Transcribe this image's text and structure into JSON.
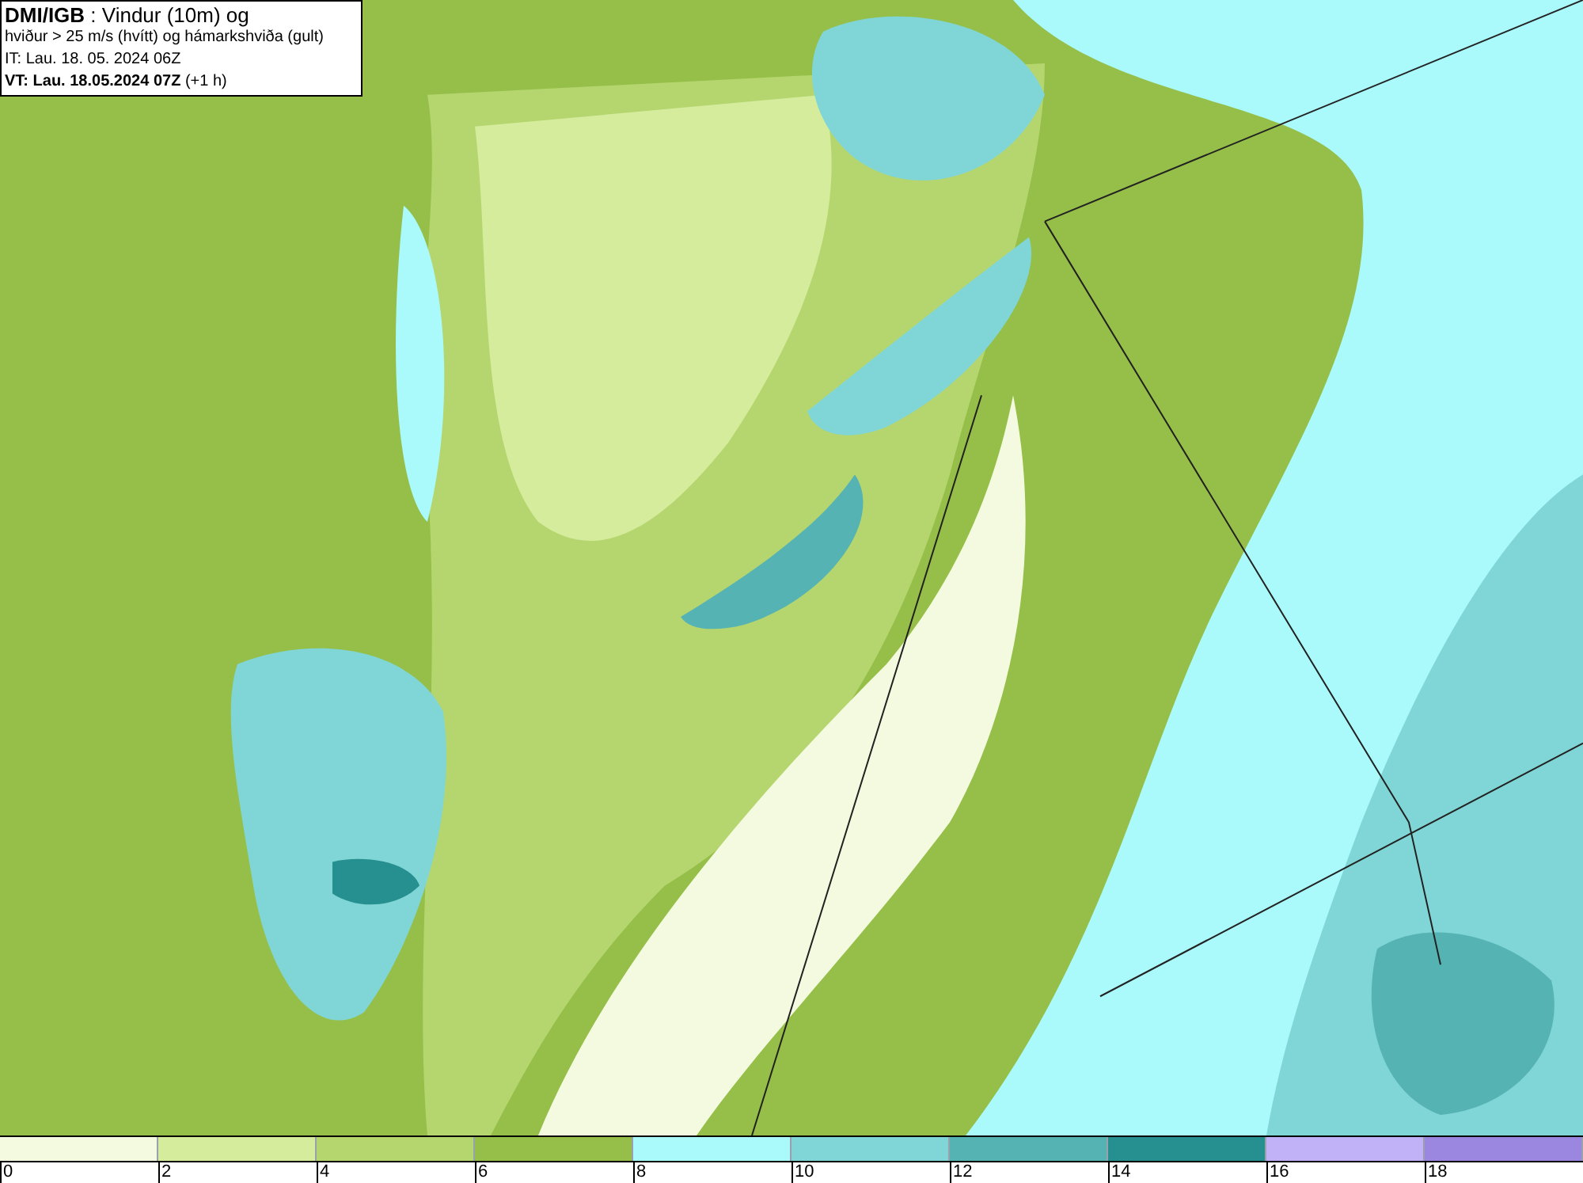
{
  "info_box": {
    "lines": [
      "**DMI/IGB** : Vindur (10m) og",
      "hviður > 25 m/s (hvítt) og hámarkshviða (gult)",
      "IT: Lau. 18. 05. 2024 06Z",
      "**VT: Lau. 18.05.2024 07Z** (+1 h)"
    ]
  },
  "legend": {
    "segments": [
      {
        "color": "#f4fadf"
      },
      {
        "color": "#d4ec9c"
      },
      {
        "color": "#b5d66f"
      },
      {
        "color": "#95bf48"
      },
      {
        "color": "#aaf9fb"
      },
      {
        "color": "#80d6d6"
      },
      {
        "color": "#56b3b3"
      },
      {
        "color": "#268f8f"
      },
      {
        "color": "#c1b2f7"
      },
      {
        "color": "#9b86e0"
      }
    ],
    "ticks": [
      "0",
      "2",
      "4",
      "6",
      "8",
      "10",
      "12",
      "14",
      "16",
      "18"
    ]
  }
}
